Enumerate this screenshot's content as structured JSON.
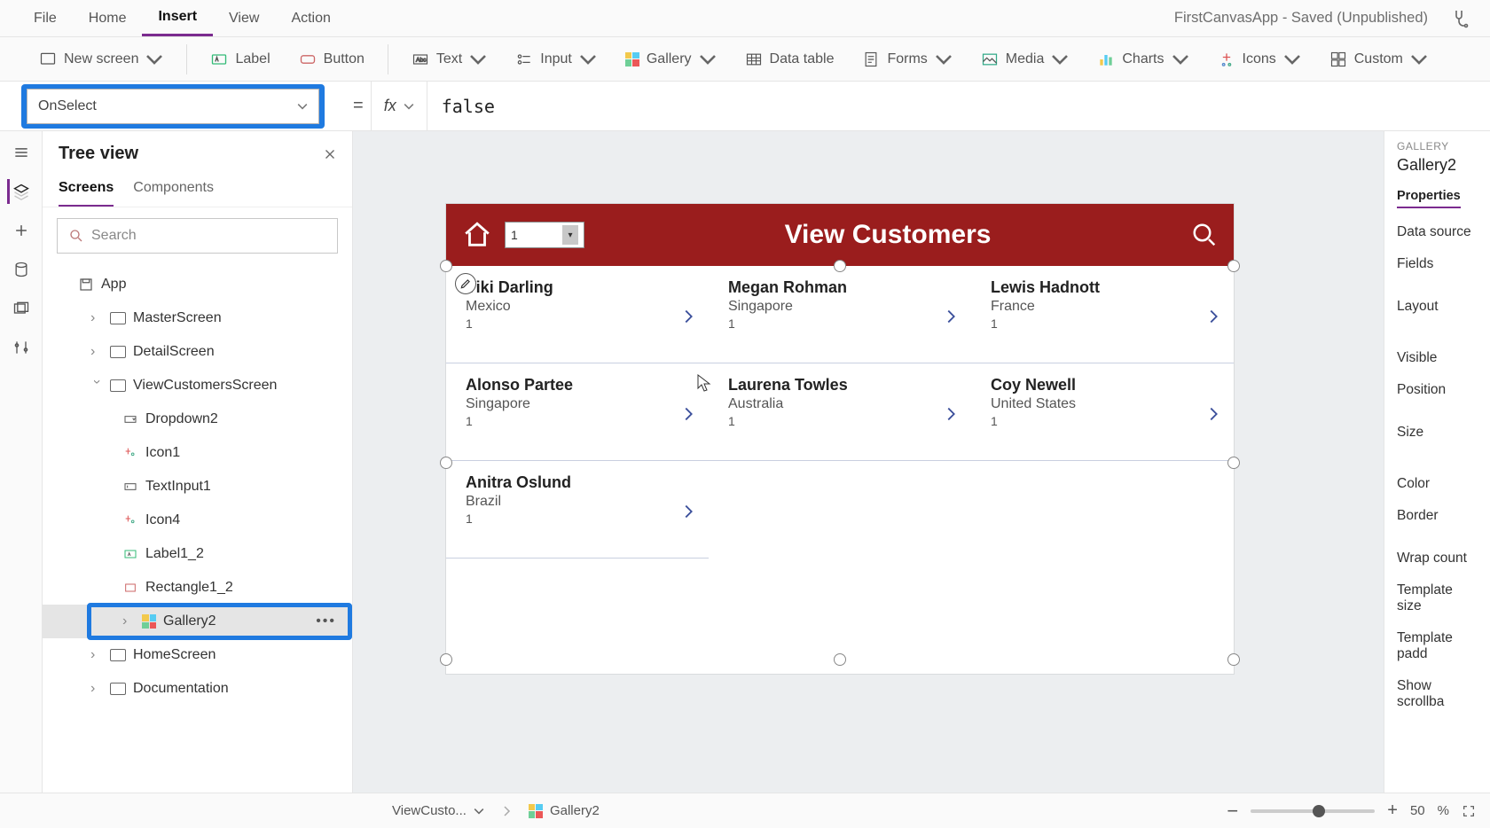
{
  "menu": {
    "file": "File",
    "home": "Home",
    "insert": "Insert",
    "view": "View",
    "action": "Action"
  },
  "doc_title": "FirstCanvasApp - Saved (Unpublished)",
  "ribbon": {
    "new_screen": "New screen",
    "label": "Label",
    "button": "Button",
    "text": "Text",
    "input": "Input",
    "gallery": "Gallery",
    "data_table": "Data table",
    "forms": "Forms",
    "media": "Media",
    "charts": "Charts",
    "icons": "Icons",
    "custom": "Custom"
  },
  "property_selector": "OnSelect",
  "formula_fx": "fx",
  "formula_value": "false",
  "tree": {
    "title": "Tree view",
    "tabs": {
      "screens": "Screens",
      "components": "Components"
    },
    "search_placeholder": "Search",
    "app": "App",
    "screens": [
      "MasterScreen",
      "DetailScreen",
      "ViewCustomersScreen",
      "HomeScreen",
      "Documentation"
    ],
    "vcs_children": [
      "Dropdown2",
      "Icon1",
      "TextInput1",
      "Icon4",
      "Label1_2",
      "Rectangle1_2",
      "Gallery2"
    ]
  },
  "canvas": {
    "header_title": "View Customers",
    "dropdown_value": "1",
    "customers": [
      {
        "name": "Viki  Darling",
        "country": "Mexico",
        "rank": "1"
      },
      {
        "name": "Megan  Rohman",
        "country": "Singapore",
        "rank": "1"
      },
      {
        "name": "Lewis  Hadnott",
        "country": "France",
        "rank": "1"
      },
      {
        "name": "Alonso  Partee",
        "country": "Singapore",
        "rank": "1"
      },
      {
        "name": "Laurena  Towles",
        "country": "Australia",
        "rank": "1"
      },
      {
        "name": "Coy  Newell",
        "country": "United States",
        "rank": "1"
      },
      {
        "name": "Anitra  Oslund",
        "country": "Brazil",
        "rank": "1"
      }
    ]
  },
  "props": {
    "type": "GALLERY",
    "name": "Gallery2",
    "tab": "Properties",
    "rows": [
      "Data source",
      "Fields",
      "Layout",
      "Visible",
      "Position",
      "Size",
      "Color",
      "Border",
      "Wrap count",
      "Template size",
      "Template padd",
      "Show scrollba"
    ]
  },
  "breadcrumb": {
    "screen": "ViewCusto...",
    "control": "Gallery2"
  },
  "zoom": {
    "value": "50",
    "pct": "%"
  }
}
